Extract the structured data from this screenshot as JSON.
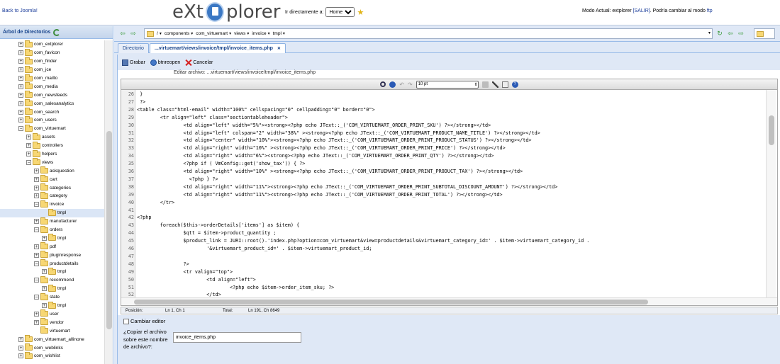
{
  "topbar": {
    "back_link": "Back to Joomla!",
    "logo_left": "eXt",
    "logo_right": "plorer",
    "goto_label": "Ir directamente a:",
    "goto_selected": "Home",
    "mode_prefix": "Modo Actual: extplorer ",
    "mode_logout": "[SALIR]",
    "mode_suffix": ". Podría cambiar al modo ",
    "mode_ftp": "ftp"
  },
  "sidebar": {
    "title": "Árbol de Directorios",
    "items": [
      {
        "label": "com_extplorer",
        "depth": 0,
        "exp": "+"
      },
      {
        "label": "com_favicon",
        "depth": 0,
        "exp": "+"
      },
      {
        "label": "com_finder",
        "depth": 0,
        "exp": "+"
      },
      {
        "label": "com_jce",
        "depth": 0,
        "exp": "+"
      },
      {
        "label": "com_mailto",
        "depth": 0,
        "exp": "+"
      },
      {
        "label": "com_media",
        "depth": 0,
        "exp": "+"
      },
      {
        "label": "com_newsfeeds",
        "depth": 0,
        "exp": "+"
      },
      {
        "label": "com_salesanalytics",
        "depth": 0,
        "exp": "+"
      },
      {
        "label": "com_search",
        "depth": 0,
        "exp": "+"
      },
      {
        "label": "com_users",
        "depth": 0,
        "exp": "+"
      },
      {
        "label": "com_virtuemart",
        "depth": 0,
        "exp": "-"
      },
      {
        "label": "assets",
        "depth": 1,
        "exp": "+"
      },
      {
        "label": "controllers",
        "depth": 1,
        "exp": "+"
      },
      {
        "label": "helpers",
        "depth": 1,
        "exp": "+"
      },
      {
        "label": "views",
        "depth": 1,
        "exp": "-"
      },
      {
        "label": "askquestion",
        "depth": 2,
        "exp": "+"
      },
      {
        "label": "cart",
        "depth": 2,
        "exp": "+"
      },
      {
        "label": "categories",
        "depth": 2,
        "exp": "+"
      },
      {
        "label": "category",
        "depth": 2,
        "exp": "+"
      },
      {
        "label": "invoice",
        "depth": 2,
        "exp": "-"
      },
      {
        "label": "tmpl",
        "depth": 3,
        "exp": "",
        "selected": true
      },
      {
        "label": "manufacturer",
        "depth": 2,
        "exp": "+"
      },
      {
        "label": "orders",
        "depth": 2,
        "exp": "-"
      },
      {
        "label": "tmpl",
        "depth": 3,
        "exp": "+"
      },
      {
        "label": "pdf",
        "depth": 2,
        "exp": "+"
      },
      {
        "label": "pluginresponse",
        "depth": 2,
        "exp": "+"
      },
      {
        "label": "productdetails",
        "depth": 2,
        "exp": "-"
      },
      {
        "label": "tmpl",
        "depth": 3,
        "exp": "+"
      },
      {
        "label": "recommend",
        "depth": 2,
        "exp": "-"
      },
      {
        "label": "tmpl",
        "depth": 3,
        "exp": "+"
      },
      {
        "label": "state",
        "depth": 2,
        "exp": "-"
      },
      {
        "label": "tmpl",
        "depth": 3,
        "exp": "+"
      },
      {
        "label": "user",
        "depth": 2,
        "exp": "+"
      },
      {
        "label": "vendor",
        "depth": 2,
        "exp": "+"
      },
      {
        "label": "virtuemart",
        "depth": 2,
        "exp": ""
      },
      {
        "label": "com_virtuemart_allinone",
        "depth": 0,
        "exp": "+"
      },
      {
        "label": "com_weblinks",
        "depth": 0,
        "exp": "+"
      },
      {
        "label": "com_wishlist",
        "depth": 0,
        "exp": "+"
      }
    ]
  },
  "pathbar": {
    "segments": [
      "/",
      "components",
      "com_virtuemart",
      "views",
      "invoice",
      "tmpl"
    ]
  },
  "tabs": [
    {
      "label": "Directorio",
      "active": false
    },
    {
      "label": "...virtuemart/views/invoice/tmpl/invoice_items.php",
      "active": true
    }
  ],
  "editor": {
    "save_label": "Grabar",
    "reopen_label": "btnreopen",
    "cancel_label": "Cancelar",
    "file_caption": "Editar archivo: ...virtuemart/views/invoice/tmpl/invoice_items.php",
    "font_size": "10 pt",
    "code_lines": [
      {
        "n": "26",
        "t": " }"
      },
      {
        "n": "27",
        "t": " ?>"
      },
      {
        "n": "28",
        "t": "<table class=\"html-email\" width=\"100%\" cellspacing=\"0\" cellpadding=\"0\" border=\"0\">"
      },
      {
        "n": "29",
        "t": "        <tr align=\"left\" class=\"sectiontableheader\">"
      },
      {
        "n": "30",
        "t": "                <td align=\"left\" width=\"5%\"><strong><?php echo JText::_('COM_VIRTUEMART_ORDER_PRINT_SKU') ?></strong></td>"
      },
      {
        "n": "31",
        "t": "                <td align=\"left\" colspan=\"2\" width=\"38%\" ><strong><?php echo JText::_('COM_VIRTUEMART_PRODUCT_NAME_TITLE') ?></strong></td>"
      },
      {
        "n": "32",
        "t": "                <td align=\"center\" width=\"10%\"><strong><?php echo JText::_('COM_VIRTUEMART_ORDER_PRINT_PRODUCT_STATUS') ?></strong></td>"
      },
      {
        "n": "33",
        "t": "                <td align=\"right\" width=\"10%\" ><strong><?php echo JText::_('COM_VIRTUEMART_ORDER_PRINT_PRICE') ?></strong></td>"
      },
      {
        "n": "34",
        "t": "                <td align=\"right\" width=\"6%\"><strong><?php echo JText::_('COM_VIRTUEMART_ORDER_PRINT_QTY') ?></strong></td>"
      },
      {
        "n": "35",
        "t": "                <?php if ( VmConfig::get('show_tax')) { ?>"
      },
      {
        "n": "36",
        "t": "                <td align=\"right\" width=\"10%\" ><strong><?php echo JText::_('COM_VIRTUEMART_ORDER_PRINT_PRODUCT_TAX') ?></strong></td>"
      },
      {
        "n": "37",
        "t": "                  <?php } ?>"
      },
      {
        "n": "38",
        "t": "                <td align=\"right\" width=\"11%\"><strong><?php echo JText::_('COM_VIRTUEMART_ORDER_PRINT_SUBTOTAL_DISCOUNT_AMOUNT') ?></strong></td>"
      },
      {
        "n": "39",
        "t": "                <td align=\"right\" width=\"11%\"><strong><?php echo JText::_('COM_VIRTUEMART_ORDER_PRINT_TOTAL') ?></strong></td>"
      },
      {
        "n": "40",
        "t": "        </tr>"
      },
      {
        "n": "41",
        "t": ""
      },
      {
        "n": "42",
        "t": "<?php"
      },
      {
        "n": "43",
        "t": "        foreach($this->orderDetails['items'] as $item) {"
      },
      {
        "n": "44",
        "t": "                $qtt = $item->product_quantity ;"
      },
      {
        "n": "45",
        "t": "                $product_link = JURI::root().'index.php?option=com_virtuemart&view=productdetails&virtuemart_category_id=' . $item->virtuemart_category_id ."
      },
      {
        "n": "46",
        "t": "                        '&virtuemart_product_id=' . $item->virtuemart_product_id;"
      },
      {
        "n": "47",
        "t": ""
      },
      {
        "n": "48",
        "t": "                ?>"
      },
      {
        "n": "49",
        "t": "                <tr valign=\"top\">"
      },
      {
        "n": "50",
        "t": "                        <td align=\"left\">"
      },
      {
        "n": "51",
        "t": "                                <?php echo $item->order_item_sku; ?>"
      },
      {
        "n": "52",
        "t": "                        </td>"
      }
    ]
  },
  "statusbar": {
    "pos_label": "Posición:",
    "pos_value": "Ln 1, Ch 1",
    "total_label": "Total:",
    "total_value": "Ln 191, Ch 8649"
  },
  "options": {
    "cambiar_label": "Cambiar editor",
    "copy_label": "¿Copiar el archivo sobre este nombre de archivo?:",
    "copy_value": "invoice_items.php"
  }
}
